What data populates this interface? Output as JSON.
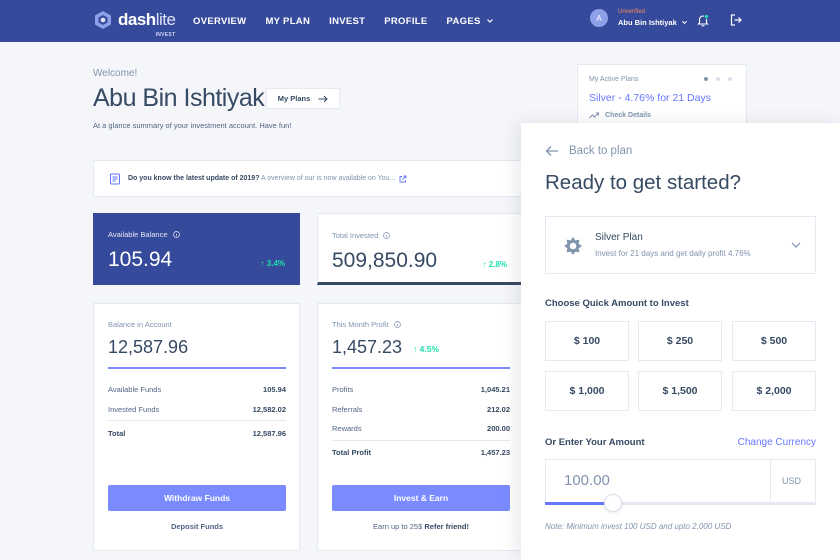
{
  "header": {
    "logo_main": "dash",
    "logo_accent": "lite",
    "logo_sub": "INVEST",
    "nav": [
      "OVERVIEW",
      "MY PLAN",
      "INVEST",
      "PROFILE",
      "PAGES"
    ],
    "user": {
      "initials": "A",
      "status": "Unverified",
      "name": "Abu Bin Ishtiyak"
    }
  },
  "welcome": {
    "greeting": "Welcome!",
    "name": "Abu Bin Ishtiyak",
    "button": "My Plans",
    "subtitle": "At a glance summary of your investment account. Have fun!"
  },
  "notice": {
    "bold": "Do you know the latest update of 2019?",
    "muted": "A overview of our is now available on You..."
  },
  "active_plans": {
    "label": "My Active Plans",
    "title": "Silver - 4.76% for 21 Days",
    "link": "Check Details"
  },
  "available_balance": {
    "label": "Available Balance",
    "value": "105.94",
    "change": "3.4%"
  },
  "total_invested": {
    "label": "Total Invested",
    "value": "509,850.90",
    "change": "2.8%"
  },
  "balance_account": {
    "label": "Balance in Account",
    "value": "12,587.96",
    "rows": [
      {
        "k": "Available Funds",
        "v": "105.94"
      },
      {
        "k": "Invested Funds",
        "v": "12,582.02"
      }
    ],
    "total": {
      "k": "Total",
      "v": "12,587.96"
    },
    "button": "Withdraw Funds",
    "link": "Deposit Funds"
  },
  "month_profit": {
    "label": "This Month Profit",
    "value": "1,457.23",
    "change": "4.5%",
    "rows": [
      {
        "k": "Profits",
        "v": "1,045.21"
      },
      {
        "k": "Referrals",
        "v": "212.02"
      },
      {
        "k": "Rewards",
        "v": "200.00"
      }
    ],
    "total": {
      "k": "Total Profit",
      "v": "1,457.23"
    },
    "button": "Invest & Earn",
    "footer_text": "Earn up to 25$",
    "footer_link": "Refer friend!"
  },
  "drawer": {
    "back": "Back to plan",
    "title": "Ready to get started?",
    "plan": {
      "name": "Silver Plan",
      "desc": "Invest for 21 days and get daily profit 4.76%"
    },
    "quick_label": "Choose Quick Amount to Invest",
    "amounts": [
      "$ 100",
      "$ 250",
      "$ 500",
      "$ 1,000",
      "$ 1,500",
      "$ 2,000"
    ],
    "enter_label": "Or Enter Your Amount",
    "change_currency": "Change Currency",
    "amount_value": "100.00",
    "currency": "USD",
    "slider_fraction": 0.25,
    "note": "Note: Minimum invest 100 USD and upto 2,000 USD"
  },
  "colors": {
    "header_bg": "#364a9b",
    "accent": "#798bff",
    "link": "#6576ff",
    "positive": "#1ee0ac",
    "unverified": "#f4875d"
  }
}
